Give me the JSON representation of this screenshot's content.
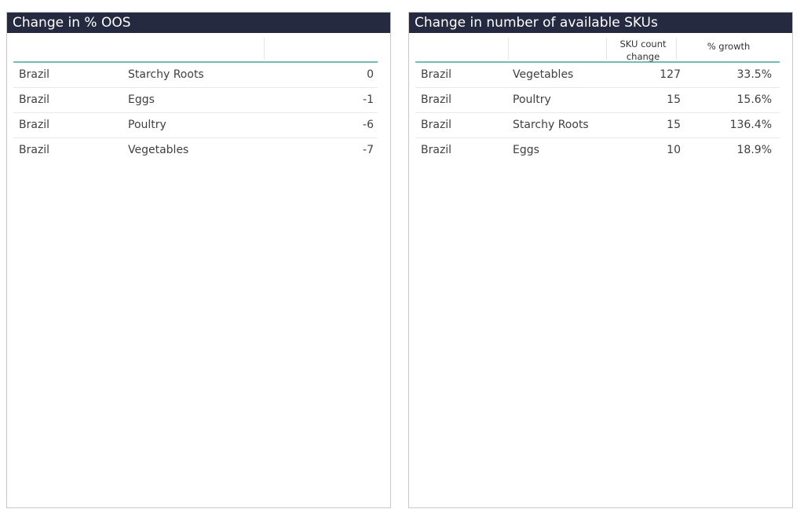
{
  "left_panel": {
    "title": "Change in % OOS",
    "rows": [
      {
        "country": "Brazil",
        "category": "Starchy Roots",
        "value": "0"
      },
      {
        "country": "Brazil",
        "category": "Eggs",
        "value": "-1"
      },
      {
        "country": "Brazil",
        "category": "Poultry",
        "value": "-6"
      },
      {
        "country": "Brazil",
        "category": "Vegetables",
        "value": "-7"
      }
    ]
  },
  "right_panel": {
    "title": "Change in number of available SKUs",
    "headers": {
      "sku_count_change": "SKU count change",
      "pct_growth": "% growth"
    },
    "rows": [
      {
        "country": "Brazil",
        "category": "Vegetables",
        "sku_count_change": "127",
        "pct_growth": "33.5%"
      },
      {
        "country": "Brazil",
        "category": "Poultry",
        "sku_count_change": "15",
        "pct_growth": "15.6%"
      },
      {
        "country": "Brazil",
        "category": "Starchy Roots",
        "sku_count_change": "15",
        "pct_growth": "136.4%"
      },
      {
        "country": "Brazil",
        "category": "Eggs",
        "sku_count_change": "10",
        "pct_growth": "18.9%"
      }
    ]
  }
}
